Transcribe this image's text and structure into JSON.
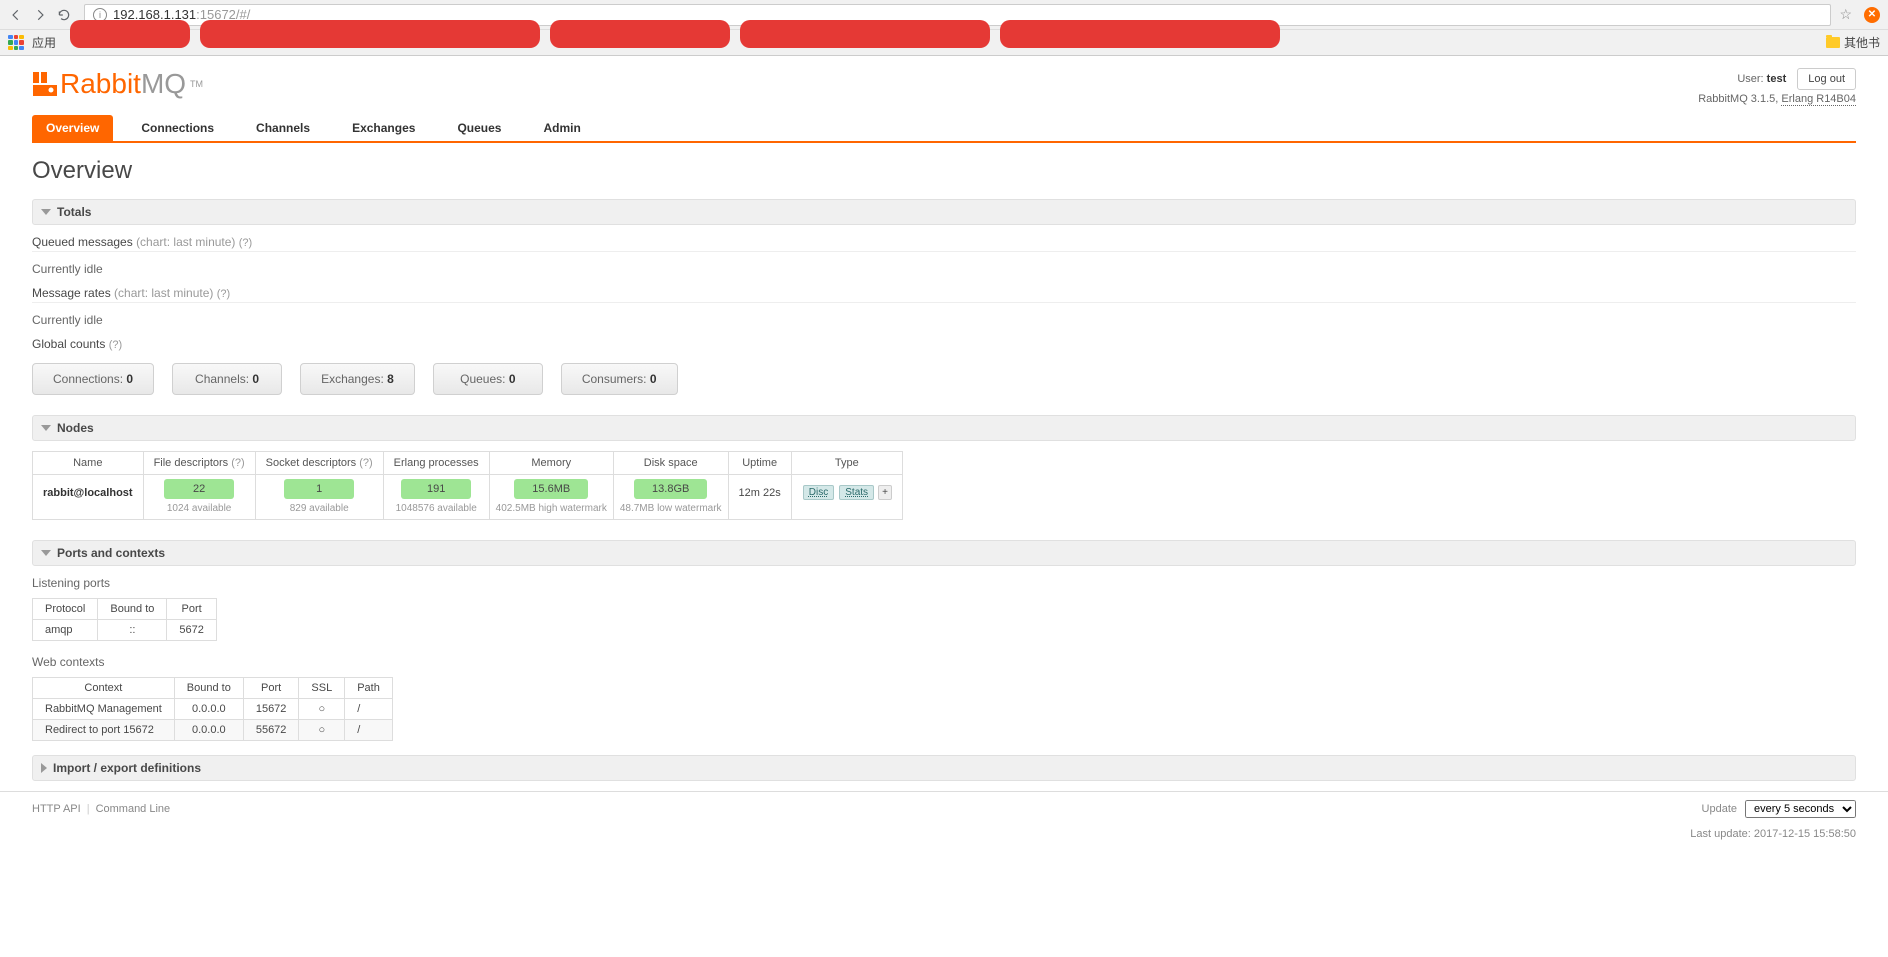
{
  "browser": {
    "url_host": "192.168.1.131",
    "url_rest": ":15672/#/",
    "apps_label": "应用",
    "other_bookmarks": "其他书"
  },
  "header": {
    "logo_text": "Rabbit",
    "logo_mq": "MQ",
    "logo_tm": "TM",
    "user_label": "User: ",
    "user_name": "test",
    "version": "RabbitMQ 3.1.5, ",
    "erlang": "Erlang R14B04",
    "logout": "Log out"
  },
  "tabs": [
    "Overview",
    "Connections",
    "Channels",
    "Exchanges",
    "Queues",
    "Admin"
  ],
  "page_title": "Overview",
  "totals": {
    "heading": "Totals",
    "queued_label": "Queued messages ",
    "chart_hint": "(chart: last minute) ",
    "help": "(?)",
    "idle": "Currently idle",
    "rates_label": "Message rates ",
    "global_label": "Global counts ",
    "counts": [
      {
        "label": "Connections: ",
        "value": "0"
      },
      {
        "label": "Channels: ",
        "value": "0"
      },
      {
        "label": "Exchanges: ",
        "value": "8"
      },
      {
        "label": "Queues: ",
        "value": "0"
      },
      {
        "label": "Consumers: ",
        "value": "0"
      }
    ]
  },
  "nodes": {
    "heading": "Nodes",
    "cols": [
      "Name",
      "File descriptors ",
      "Socket descriptors ",
      "Erlang processes",
      "Memory",
      "Disk space",
      "Uptime",
      "Type"
    ],
    "row": {
      "name": "rabbit@localhost",
      "fd_val": "22",
      "fd_sub": "1024 available",
      "sd_val": "1",
      "sd_sub": "829 available",
      "ep_val": "191",
      "ep_sub": "1048576 available",
      "mem_val": "15.6MB",
      "mem_sub": "402.5MB high watermark",
      "disk_val": "13.8GB",
      "disk_sub": "48.7MB low watermark",
      "uptime": "12m 22s",
      "tag_disc": "Disc",
      "tag_stats": "Stats",
      "tag_plus": "+"
    }
  },
  "ports": {
    "heading": "Ports and contexts",
    "listening": "Listening ports",
    "listen_cols": [
      "Protocol",
      "Bound to",
      "Port"
    ],
    "listen_row": {
      "protocol": "amqp",
      "bound": "::",
      "port": "5672"
    },
    "web": "Web contexts",
    "web_cols": [
      "Context",
      "Bound to",
      "Port",
      "SSL",
      "Path"
    ],
    "web_rows": [
      {
        "ctx": "RabbitMQ Management",
        "bound": "0.0.0.0",
        "port": "15672",
        "ssl": "○",
        "path": "/"
      },
      {
        "ctx": "Redirect to port 15672",
        "bound": "0.0.0.0",
        "port": "55672",
        "ssl": "○",
        "path": "/"
      }
    ]
  },
  "import_export": "Import / export definitions",
  "footer": {
    "api": "HTTP API",
    "cli": "Command Line",
    "update_label": "Update",
    "interval": "every 5 seconds",
    "last_update": "Last update: 2017-12-15 15:58:50"
  }
}
